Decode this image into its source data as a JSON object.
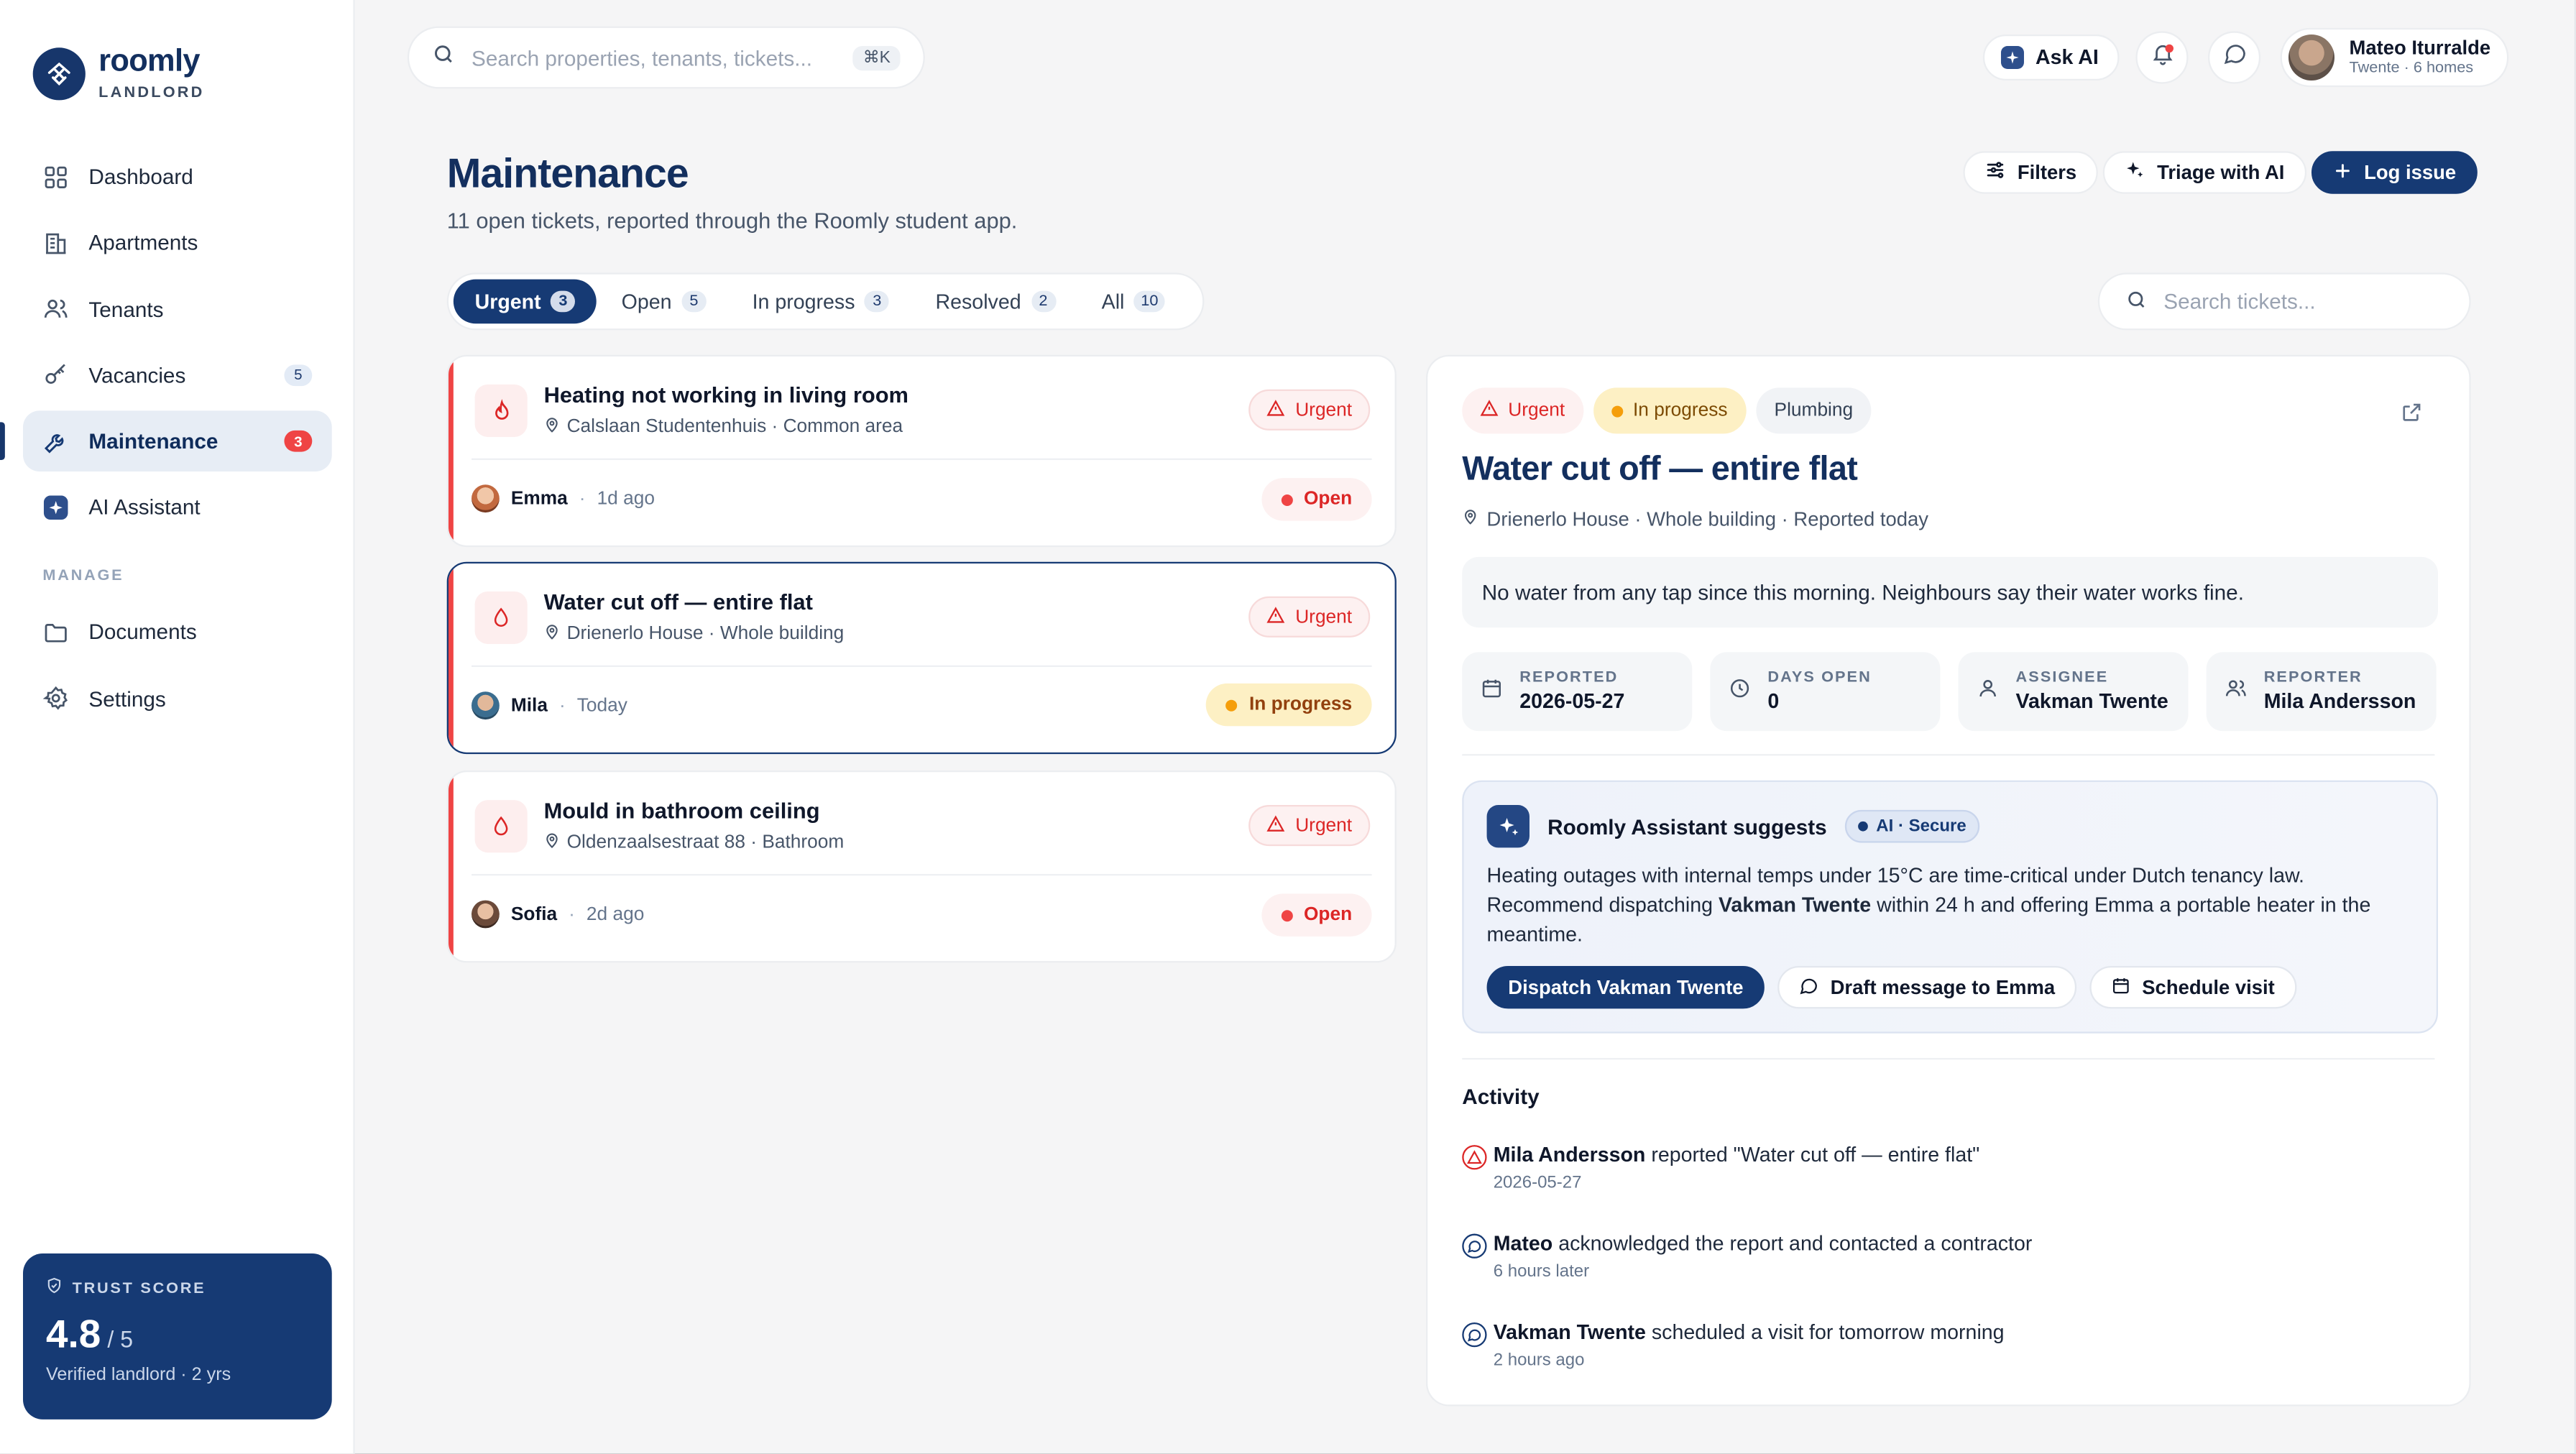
{
  "brand": {
    "name": "roomly",
    "sub": "LANDLORD"
  },
  "sidebar": {
    "items": [
      {
        "label": "Dashboard",
        "icon": "grid-icon"
      },
      {
        "label": "Apartments",
        "icon": "building-icon"
      },
      {
        "label": "Tenants",
        "icon": "users-icon"
      },
      {
        "label": "Vacancies",
        "icon": "key-icon",
        "badge": "5"
      },
      {
        "label": "Maintenance",
        "icon": "wrench-icon",
        "badge": "3",
        "active": true
      },
      {
        "label": "AI Assistant",
        "icon": "ai-icon"
      }
    ],
    "section": "MANAGE",
    "manage_items": [
      {
        "label": "Documents",
        "icon": "folder-icon"
      },
      {
        "label": "Settings",
        "icon": "gear-icon"
      }
    ],
    "trust": {
      "label": "TRUST SCORE",
      "score": "4.8",
      "out_of": "/ 5",
      "sub": "Verified landlord · 2 yrs"
    }
  },
  "topbar": {
    "search_placeholder": "Search properties, tenants, tickets...",
    "shortcut": "⌘K",
    "ask_ai": "Ask AI",
    "user": {
      "name": "Mateo Iturralde",
      "sub": "Twente · 6 homes"
    }
  },
  "page": {
    "title": "Maintenance",
    "subtitle": "11 open tickets, reported through the Roomly student app.",
    "buttons": {
      "filters": "Filters",
      "triage": "Triage with AI",
      "log": "Log issue"
    }
  },
  "tabs": [
    {
      "label": "Urgent",
      "count": "3",
      "active": true
    },
    {
      "label": "Open",
      "count": "5"
    },
    {
      "label": "In progress",
      "count": "3"
    },
    {
      "label": "Resolved",
      "count": "2"
    },
    {
      "label": "All",
      "count": "10"
    }
  ],
  "ticket_search_placeholder": "Search tickets...",
  "tickets": [
    {
      "title": "Heating not working in living room",
      "location": "Calslaan Studentenhuis · Common area",
      "priority": "Urgent",
      "reporter": "Emma",
      "time": "1d ago",
      "status": "Open",
      "icon": "flame-icon"
    },
    {
      "title": "Water cut off — entire flat",
      "location": "Drienerlo House · Whole building",
      "priority": "Urgent",
      "reporter": "Mila",
      "time": "Today",
      "status": "In progress",
      "icon": "drop-icon"
    },
    {
      "title": "Mould in bathroom ceiling",
      "location": "Oldenzaalsestraat 88 · Bathroom",
      "priority": "Urgent",
      "reporter": "Sofia",
      "time": "2d ago",
      "status": "Open",
      "icon": "drop-icon"
    }
  ],
  "detail": {
    "chips": {
      "priority": "Urgent",
      "status": "In progress",
      "category": "Plumbing"
    },
    "title": "Water cut off — entire flat",
    "location": "Drienerlo House · Whole building · Reported today",
    "description": "No water from any tap since this morning. Neighbours say their water works fine.",
    "meta": [
      {
        "label": "REPORTED",
        "value": "2026-05-27",
        "icon": "calendar-icon"
      },
      {
        "label": "DAYS OPEN",
        "value": "0",
        "icon": "clock-icon"
      },
      {
        "label": "ASSIGNEE",
        "value": "Vakman Twente",
        "icon": "user-icon"
      },
      {
        "label": "REPORTER",
        "value": "Mila Andersson",
        "icon": "users-icon"
      }
    ],
    "ai": {
      "title": "Roomly Assistant suggests",
      "badge": "AI · Secure",
      "text_1": "Heating outages with internal temps under 15°C are time-critical under Dutch tenancy law. Recommend dispatching ",
      "text_bold": "Vakman Twente",
      "text_2": " within 24 h and offering Emma a portable heater in the meantime.",
      "actions": {
        "dispatch": "Dispatch Vakman Twente",
        "draft": "Draft message to Emma",
        "schedule": "Schedule visit"
      }
    },
    "activity_title": "Activity",
    "activity": [
      {
        "actor": "Mila Andersson",
        "text": " reported \"Water cut off — entire flat\"",
        "time": "2026-05-27",
        "icon": "alert-icon"
      },
      {
        "actor": "Mateo",
        "text": " acknowledged the report and contacted a contractor",
        "time": "6 hours later",
        "icon": "chat-icon"
      },
      {
        "actor": "Vakman Twente",
        "text": " scheduled a visit for tomorrow morning",
        "time": "2 hours ago",
        "icon": "chat-icon"
      }
    ]
  },
  "colors": {
    "primary": "#163a74",
    "urgent": "#dc2626",
    "progress": "#f59e0b",
    "background": "#f5f5f6"
  }
}
